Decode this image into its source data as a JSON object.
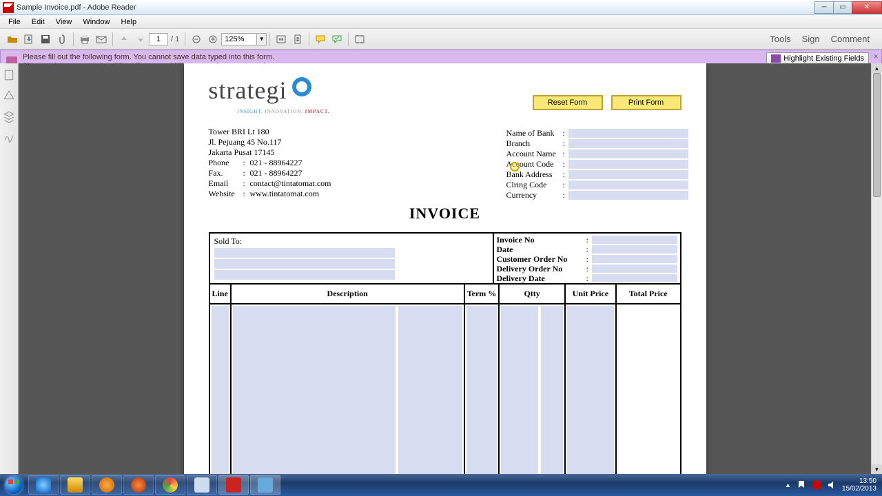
{
  "window": {
    "title": "Sample Invoice.pdf - Adobe Reader"
  },
  "menu": {
    "file": "File",
    "edit": "Edit",
    "view": "View",
    "window": "Window",
    "help": "Help"
  },
  "toolbar": {
    "page_current": "1",
    "page_sep": "/",
    "page_total": "1",
    "zoom": "125%",
    "panes": {
      "tools": "Tools",
      "sign": "Sign",
      "comment": "Comment"
    }
  },
  "notice": {
    "line1": "Please fill out the following form. You cannot save data typed into this form.",
    "line2": "Please print your completed form if you would like a copy for your records.",
    "highlight_btn": "Highlight Existing Fields"
  },
  "doc": {
    "logo": "strategi",
    "tagline": {
      "a": "INSIGHT.",
      "b": "INNOVATION.",
      "c": "IMPACT."
    },
    "buttons": {
      "reset": "Reset Form",
      "print": "Print Form"
    },
    "address": {
      "l1": "Tower BRI Lt 180",
      "l2": "Jl. Pejuang 45 No.117",
      "l3": "Jakarta Pusat 17145",
      "phone_lbl": "Phone",
      "phone": "021 - 88964227",
      "fax_lbl": "Fax.",
      "fax": "021 - 88964227",
      "email_lbl": "Email",
      "email": "contact@tintatomat.com",
      "web_lbl": "Website",
      "web": "www.tintatomat.com"
    },
    "bank": {
      "name": "Name of Bank",
      "branch": "Branch",
      "acct_name": "Account Name",
      "acct_code": "Account Code",
      "addr": "Bank Address",
      "clring": "Clring Code",
      "currency": "Currency"
    },
    "title": "INVOICE",
    "soldto": "Sold To:",
    "meta": {
      "inv_no": "Invoice No",
      "date": "Date",
      "cust_order": "Customer Order No",
      "deliv_order": "Delivery Order No",
      "deliv_date": "Delivery Date"
    },
    "cols": {
      "line": "Line",
      "desc": "Description",
      "term": "Term %",
      "qty": "Qtty",
      "price": "Unit Price",
      "total": "Total Price"
    }
  },
  "tray": {
    "time": "13:50",
    "date": "15/02/2013"
  }
}
